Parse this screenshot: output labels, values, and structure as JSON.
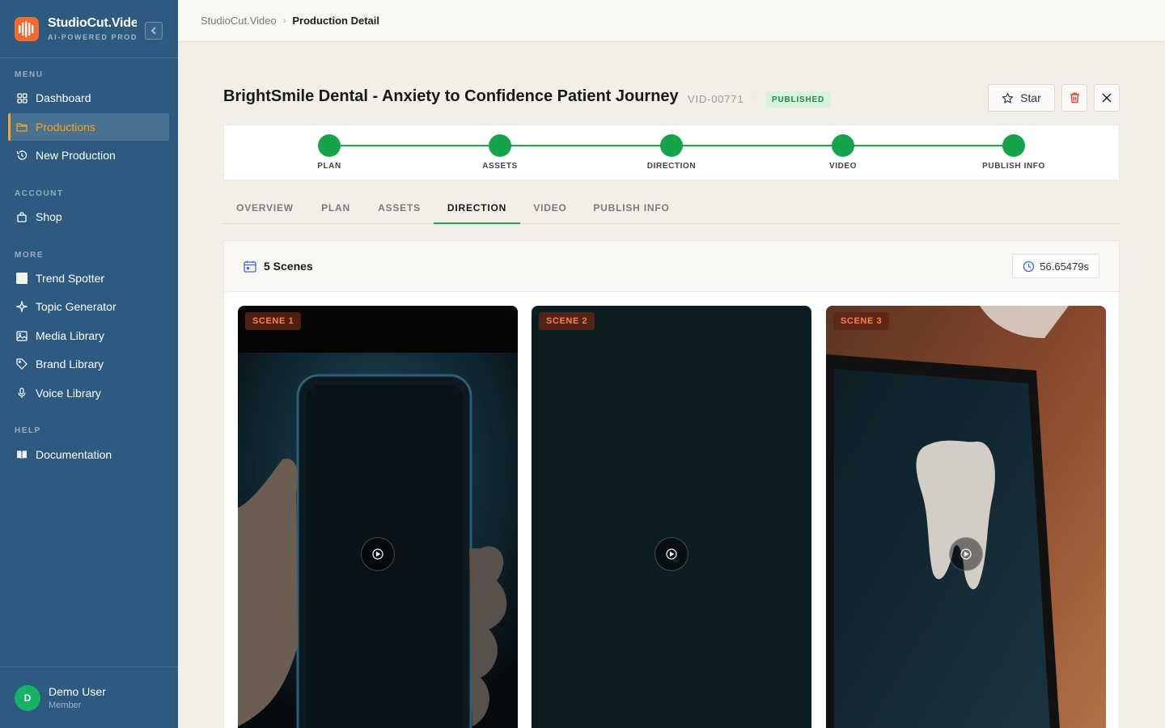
{
  "app": {
    "name": "StudioCut.Vide",
    "tagline": "AI-POWERED PRODUCTION"
  },
  "sidebar": {
    "sections": [
      {
        "label": "MENU"
      },
      {
        "label": "ACCOUNT"
      },
      {
        "label": "MORE"
      },
      {
        "label": "HELP"
      }
    ],
    "items": [
      {
        "label": "Dashboard",
        "icon": "grid-icon"
      },
      {
        "label": "Productions",
        "icon": "folder-icon",
        "active": true
      },
      {
        "label": "New Production",
        "icon": "history-icon"
      },
      {
        "label": "Shop",
        "icon": "bag-icon"
      },
      {
        "label": "Trend Spotter",
        "icon": "chart-square-icon"
      },
      {
        "label": "Topic Generator",
        "icon": "sparkle-icon"
      },
      {
        "label": "Media Library",
        "icon": "image-icon"
      },
      {
        "label": "Brand Library",
        "icon": "tag-icon"
      },
      {
        "label": "Voice Library",
        "icon": "microphone-icon"
      },
      {
        "label": "Documentation",
        "icon": "book-icon"
      }
    ],
    "user": {
      "initial": "D",
      "name": "Demo User",
      "role": "Member"
    }
  },
  "breadcrumb": {
    "root": "StudioCut.Video",
    "separator": "›",
    "current": "Production Detail"
  },
  "production": {
    "title": "BrightSmile Dental - Anxiety to Confidence Patient Journey",
    "id": "VID-00771",
    "separator": "·",
    "status": "PUBLISHED"
  },
  "actions": {
    "star_label": "Star"
  },
  "stepper": {
    "steps": [
      "PLAN",
      "ASSETS",
      "DIRECTION",
      "VIDEO",
      "PUBLISH INFO"
    ]
  },
  "tabs": {
    "items": [
      "OVERVIEW",
      "PLAN",
      "ASSETS",
      "DIRECTION",
      "VIDEO",
      "PUBLISH INFO"
    ],
    "active": "DIRECTION"
  },
  "scenes": {
    "count_label": "5 Scenes",
    "duration": "56.65479s",
    "items": [
      {
        "label": "SCENE 1"
      },
      {
        "label": "SCENE 2"
      },
      {
        "label": "SCENE 3"
      }
    ]
  },
  "colors": {
    "sidebar_bg": "#2c5a80",
    "accent_active": "#f5a623",
    "success": "#17a34a",
    "brand_logo": "#f26a2e"
  }
}
